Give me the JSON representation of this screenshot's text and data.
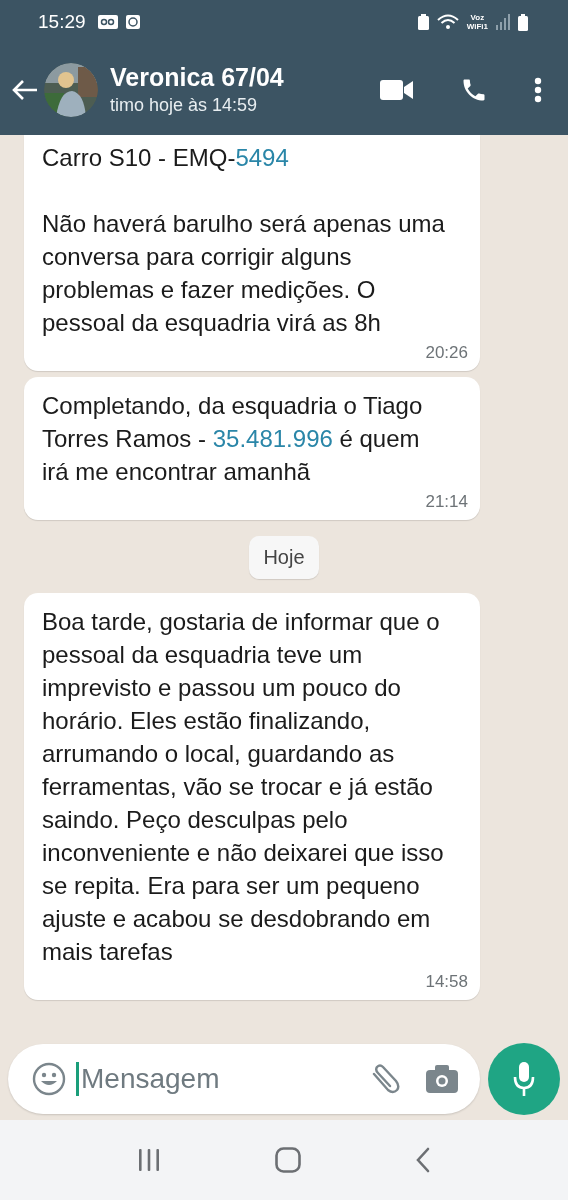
{
  "status_bar": {
    "time": "15:29",
    "voice_label": "Voz",
    "wifi_label": "WiFi1"
  },
  "header": {
    "title": "Veronica 67/04",
    "subtitle": "timo hoje às 14:59"
  },
  "messages": [
    {
      "kind": "message",
      "cut_top": true,
      "parts": [
        {
          "kind": "text",
          "text": "Carro S10 - EMQ-"
        },
        {
          "kind": "link",
          "text": "5494"
        },
        {
          "kind": "text",
          "text": "\n\nNão haverá barulho será apenas uma conversa para corrigir alguns problemas e fazer medições. O pessoal da esquadria virá as 8h"
        }
      ],
      "time": "20:26"
    },
    {
      "kind": "message",
      "cut_top": false,
      "parts": [
        {
          "kind": "text",
          "text": "Completando, da esquadria o Tiago Torres Ramos - "
        },
        {
          "kind": "link",
          "text": "35.481.996"
        },
        {
          "kind": "text",
          "text": " é quem irá me encontrar amanhã"
        }
      ],
      "time": "21:14"
    },
    {
      "kind": "date",
      "text": "Hoje"
    },
    {
      "kind": "message",
      "cut_top": false,
      "parts": [
        {
          "kind": "text",
          "text": "Boa tarde, gostaria de informar que o pessoal da esquadria teve um imprevisto e passou um pouco do horário. Eles estão finalizando, arrumando o local, guardando as ferramentas, vão se trocar e já estão saindo. Peço desculpas pelo inconveniente e não deixarei que isso se repita. Era para ser um pequeno ajuste e acabou se desdobrando em mais tarefas"
        }
      ],
      "time": "14:58"
    }
  ],
  "composer": {
    "placeholder": "Mensagem"
  }
}
